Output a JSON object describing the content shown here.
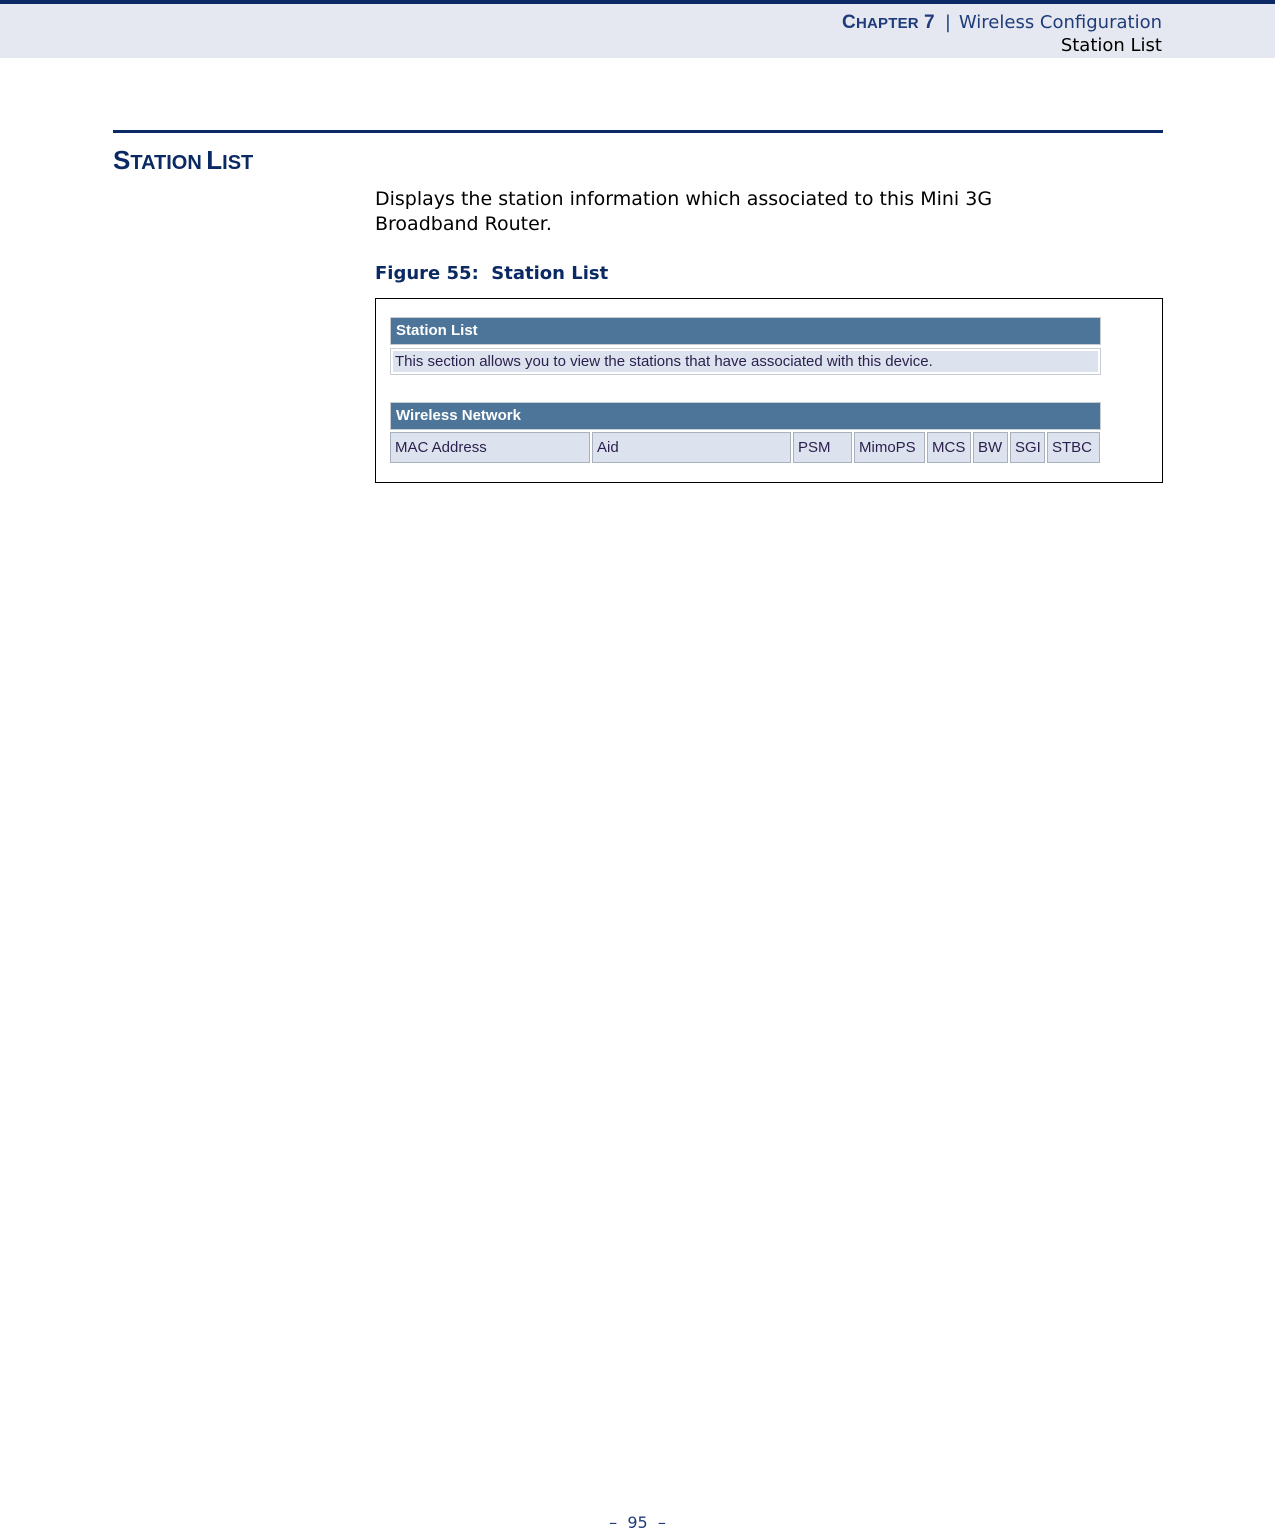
{
  "header": {
    "chapter_label_initial": "C",
    "chapter_label_rest": "HAPTER",
    "chapter_number": "7",
    "separator": "|",
    "chapter_title": "Wireless Configuration",
    "section_name": "Station List"
  },
  "section": {
    "title_initial_1": "S",
    "title_rest_1": "TATION",
    "title_initial_2": "L",
    "title_rest_2": "IST",
    "description": "Displays the station information which associated to this Mini 3G Broadband Router."
  },
  "figure": {
    "caption": "Figure 55:  Station List",
    "station_list_panel": {
      "title": "Station List",
      "description": "This section allows you to view the stations that have associated with this device."
    },
    "wireless_network_table": {
      "title": "Wireless Network",
      "columns": [
        "MAC Address",
        "Aid",
        "PSM",
        "MimoPS",
        "MCS",
        "BW",
        "SGI",
        "STBC"
      ]
    }
  },
  "footer": {
    "page_number": "–  95  –"
  },
  "colors": {
    "brand_navy": "#0b2a63",
    "header_band": "#e5e8f0",
    "table_title_bg": "#4d7499",
    "table_cell_bg": "#dde3ee"
  }
}
